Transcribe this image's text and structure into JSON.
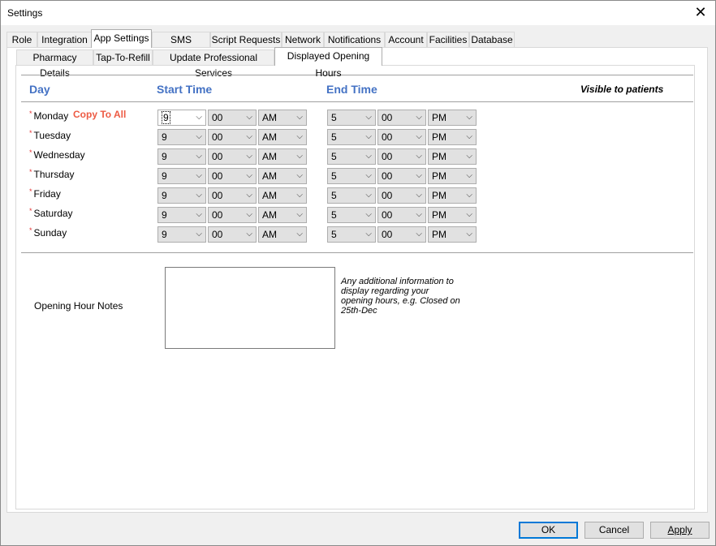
{
  "window": {
    "title": "Settings",
    "close_glyph": "✕"
  },
  "main_tabs": [
    {
      "label": "Role"
    },
    {
      "label": "Integration"
    },
    {
      "label": "App Settings"
    },
    {
      "label": "SMS Options"
    },
    {
      "label": "Script Requests"
    },
    {
      "label": "Network"
    },
    {
      "label": "Notifications"
    },
    {
      "label": "Account"
    },
    {
      "label": "Facilities"
    },
    {
      "label": "Database"
    }
  ],
  "sub_tabs": [
    {
      "label": "Pharmacy Details"
    },
    {
      "label": "Tap-To-Refill"
    },
    {
      "label": "Update Professional Services"
    },
    {
      "label": "Displayed Opening Hours"
    }
  ],
  "headers": {
    "day": "Day",
    "start": "Start Time",
    "end": "End Time",
    "visible": "Visible to patients"
  },
  "copy_to_all": "Copy To All",
  "required_mark": "*",
  "days": [
    {
      "name": "Monday",
      "sh": "9",
      "sm": "00",
      "sa": "AM",
      "eh": "5",
      "em": "00",
      "ea": "PM"
    },
    {
      "name": "Tuesday",
      "sh": "9",
      "sm": "00",
      "sa": "AM",
      "eh": "5",
      "em": "00",
      "ea": "PM"
    },
    {
      "name": "Wednesday",
      "sh": "9",
      "sm": "00",
      "sa": "AM",
      "eh": "5",
      "em": "00",
      "ea": "PM"
    },
    {
      "name": "Thursday",
      "sh": "9",
      "sm": "00",
      "sa": "AM",
      "eh": "5",
      "em": "00",
      "ea": "PM"
    },
    {
      "name": "Friday",
      "sh": "9",
      "sm": "00",
      "sa": "AM",
      "eh": "5",
      "em": "00",
      "ea": "PM"
    },
    {
      "name": "Saturday",
      "sh": "9",
      "sm": "00",
      "sa": "AM",
      "eh": "5",
      "em": "00",
      "ea": "PM"
    },
    {
      "name": "Sunday",
      "sh": "9",
      "sm": "00",
      "sa": "AM",
      "eh": "5",
      "em": "00",
      "ea": "PM"
    }
  ],
  "notes": {
    "label": "Opening Hour Notes",
    "value": "",
    "hint": "Any additional information to display regarding your opening hours, e.g. Closed on 25th-Dec"
  },
  "buttons": {
    "ok": "OK",
    "cancel": "Cancel",
    "apply": "Apply"
  },
  "colors": {
    "header_blue": "#4472c4",
    "copy_red": "#ed5b44",
    "focus_blue": "#0078d7"
  }
}
